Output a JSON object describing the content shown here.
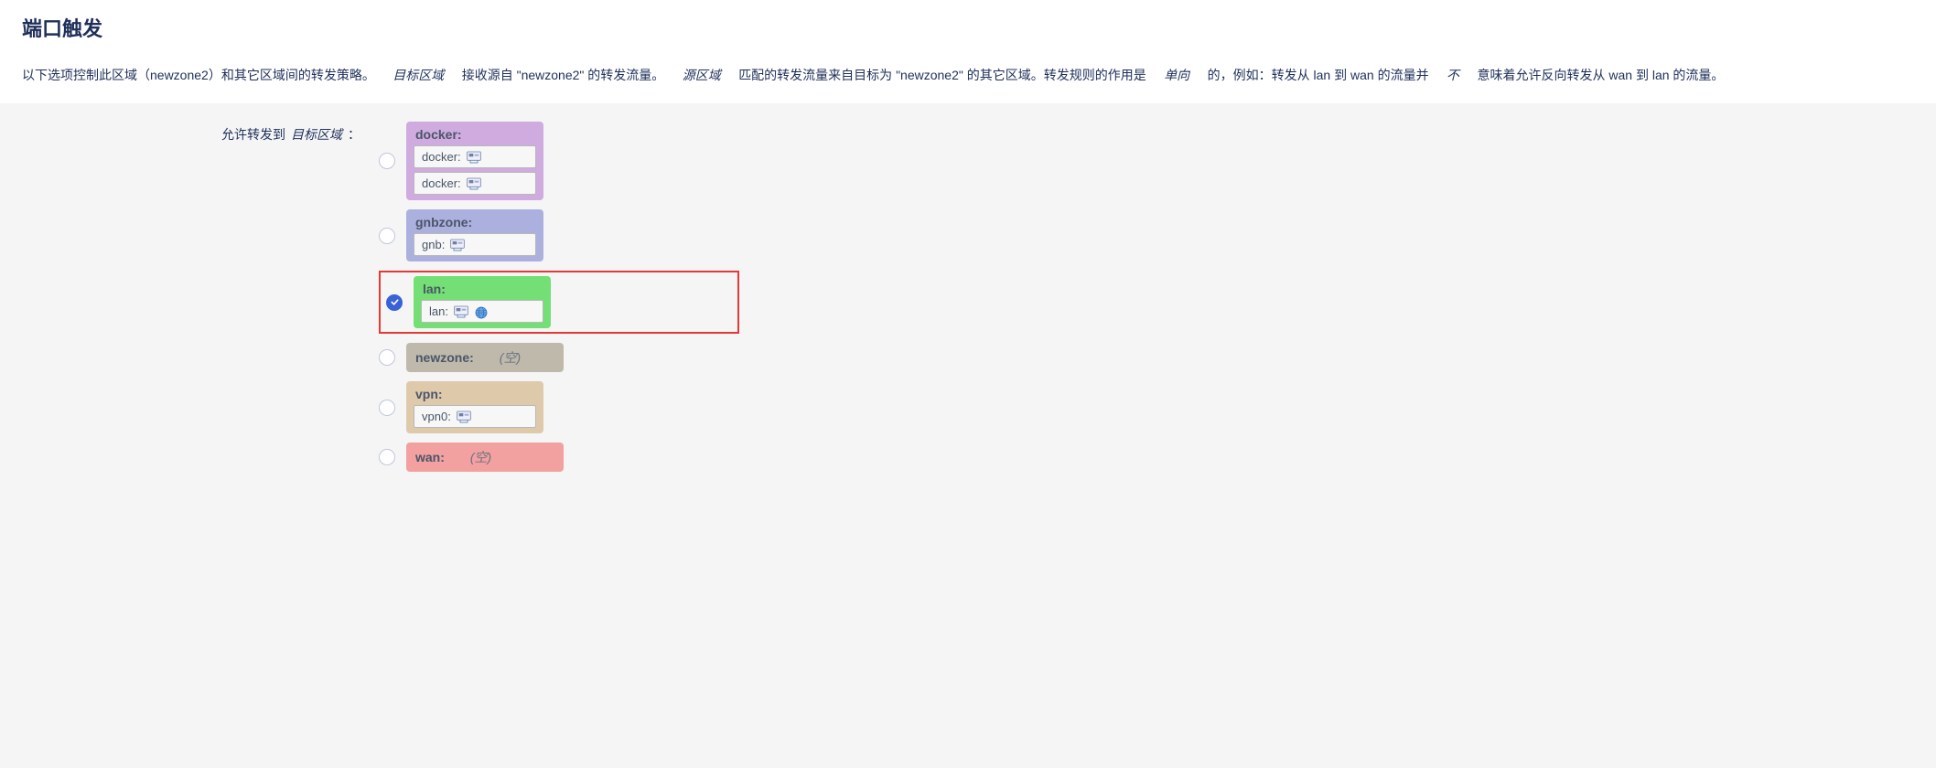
{
  "page": {
    "title": "端口触发"
  },
  "desc": {
    "t1": "以下选项控制此区域（newzone2）和其它区域间的转发策略。",
    "em1": "目标区域",
    "t2": "接收源自 \"newzone2\" 的转发流量。",
    "em2": "源区域",
    "t3": "匹配的转发流量来自目标为 \"newzone2\" 的其它区域。转发规则的作用是",
    "em3": "单向",
    "t4": "的，例如：转发从 lan 到 wan 的流量并",
    "em4": "不",
    "t5": "意味着允许反向转发从 wan 到 lan 的流量。"
  },
  "form": {
    "label_pre": "允许转发到",
    "label_em": "目标区域",
    "label_colon": "："
  },
  "zones": [
    {
      "key": "docker",
      "title": "docker:",
      "class": "zone-docker",
      "ifaces": [
        "docker:",
        "docker:"
      ],
      "checked": false,
      "highlighted": false
    },
    {
      "key": "gnbzone",
      "title": "gnbzone:",
      "class": "zone-gnb",
      "ifaces": [
        "gnb:"
      ],
      "checked": false,
      "highlighted": false
    },
    {
      "key": "lan",
      "title": "lan:",
      "class": "zone-lan",
      "ifaces": [
        "lan:"
      ],
      "extraIcon": true,
      "checked": true,
      "highlighted": true
    },
    {
      "key": "newzone",
      "title": "newzone:",
      "class": "zone-newzone",
      "empty": true,
      "empty_label": "(空)",
      "checked": false,
      "highlighted": false
    },
    {
      "key": "vpn",
      "title": "vpn:",
      "class": "zone-vpn",
      "ifaces": [
        "vpn0:"
      ],
      "checked": false,
      "highlighted": false
    },
    {
      "key": "wan",
      "title": "wan:",
      "class": "zone-wan",
      "empty": true,
      "empty_label": "(空)",
      "checked": false,
      "highlighted": false
    }
  ]
}
